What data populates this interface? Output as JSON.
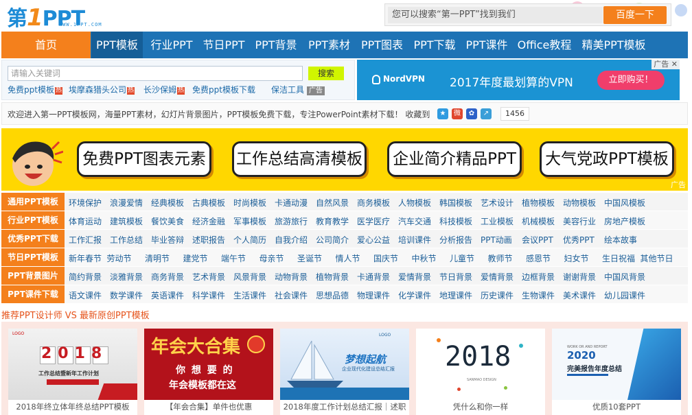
{
  "header": {
    "logo_text_a": "第",
    "logo_text_b": "1",
    "logo_text_c": "PPT",
    "logo_url": "WWW.1PPT.COM",
    "search_placeholder": "您可以搜索“第一PPT”找到我们",
    "search_button": "百度一下"
  },
  "nav": {
    "items": [
      "首页",
      "PPT模板",
      "行业PPT",
      "节日PPT",
      "PPT背景",
      "PPT素材",
      "PPT图表",
      "PPT下载",
      "PPT课件",
      "Office教程",
      "精美PPT模板"
    ]
  },
  "keyword_search": {
    "placeholder": "请输入关键词",
    "button": "搜索",
    "hot_links": [
      "免费ppt模板",
      "埃摩森猎头公司",
      "长沙保姆",
      "免费ppt模板下载",
      "保洁工具"
    ],
    "hot_tag": "热",
    "ad_tag": "广告"
  },
  "vpn_ad": {
    "brand": "NordVPN",
    "headline": "2017年度最划算的VPN",
    "cta": "立即购买！",
    "ad_mark": "广告"
  },
  "welcome": {
    "text": "欢迎进入第一PPT模板网，海量PPT素材，幻灯片背景图片，PPT模板免费下载，专注PowerPoint素材下载！",
    "fav_label": "收藏到",
    "count": "1456"
  },
  "banner": {
    "pills": [
      "免费PPT图表元素",
      "工作总结高清模板",
      "企业简介精品PPT",
      "大气党政PPT模板"
    ],
    "ad_text": "广告"
  },
  "categories": [
    {
      "label": "通用PPT模板",
      "links": [
        "环境保护",
        "浪漫爱情",
        "经典模板",
        "古典模板",
        "时尚模板",
        "卡通动漫",
        "自然风景",
        "商务模板",
        "人物模板",
        "韩国模板",
        "艺术设计",
        "植物模板",
        "动物模板",
        "中国风模板"
      ]
    },
    {
      "label": "行业PPT模板",
      "links": [
        "体育运动",
        "建筑模板",
        "餐饮美食",
        "经济金融",
        "军事模板",
        "旅游旅行",
        "教育教学",
        "医学医疗",
        "汽车交通",
        "科技模板",
        "工业模板",
        "机械模板",
        "美容行业",
        "房地产模板"
      ]
    },
    {
      "label": "优秀PPT下载",
      "links": [
        "工作汇报",
        "工作总结",
        "毕业答辩",
        "述职报告",
        "个人简历",
        "自我介绍",
        "公司简介",
        "爱心公益",
        "培训课件",
        "分析报告",
        "PPT动画",
        "会议PPT",
        "优秀PPT",
        "绘本故事"
      ]
    },
    {
      "label": "节日PPT模板",
      "links": [
        "新年春节",
        "劳动节",
        "清明节",
        "建党节",
        "端午节",
        "母亲节",
        "圣诞节",
        "情人节",
        "国庆节",
        "中秋节",
        "儿童节",
        "教师节",
        "感恩节",
        "妇女节",
        "生日祝福",
        "其他节日"
      ]
    },
    {
      "label": "PPT背景图片",
      "links": [
        "简约背景",
        "淡雅背景",
        "商务背景",
        "艺术背景",
        "风景背景",
        "动物背景",
        "植物背景",
        "卡通背景",
        "爱情背景",
        "节日背景",
        "爱情背景",
        "边框背景",
        "谢谢背景",
        "中国风背景"
      ]
    },
    {
      "label": "PPT课件下载",
      "links": [
        "语文课件",
        "数学课件",
        "英语课件",
        "科学课件",
        "生活课件",
        "社会课件",
        "思想品德",
        "物理课件",
        "化学课件",
        "地理课件",
        "历史课件",
        "生物课件",
        "美术课件",
        "幼儿园课件"
      ]
    }
  ],
  "recommend": {
    "title": "推荐PPT设计师 VS 最新原创PPT模板",
    "cards": [
      {
        "caption": "2018年终立体年终总结PPT模板",
        "img_title": "2018",
        "img_sub": "工作总结暨新年工作计划",
        "logo": "LOGO"
      },
      {
        "caption": "【年会合集】单件也优惠",
        "img_title": "年会大合集",
        "img_sub": "你 想 要 的",
        "img_sub2": "年会模板都在这"
      },
      {
        "caption": "2018年度工作计划总结汇报｜述职",
        "img_title": "梦想起航",
        "img_sub": "企业现代化建设总结汇报",
        "logo": "LOGO"
      },
      {
        "caption": "凭什么和你一样",
        "img_title": "2018",
        "img_sub": "SANMAO DESIGN"
      },
      {
        "caption": "优质10套PPT",
        "img_title": "2020",
        "img_sub": "完美报告年度总结",
        "img_top": "WORK OR AND REPORT"
      }
    ]
  },
  "colors": {
    "brand_blue": "#1e73b5",
    "brand_orange": "#f4801c",
    "banner_yellow": "#ffd700",
    "link_blue": "#1d5f98"
  }
}
